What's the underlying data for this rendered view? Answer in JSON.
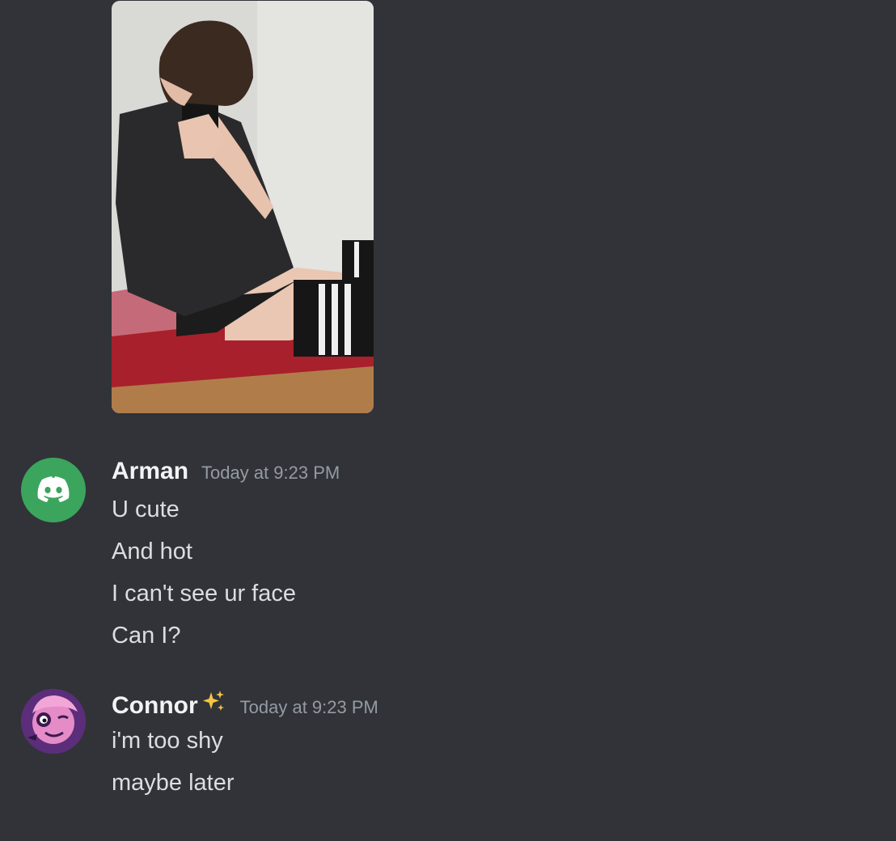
{
  "messages": [
    {
      "author": "Arman",
      "timestamp": "Today at 9:23 PM",
      "avatar_icon": "discord-logo-icon",
      "avatar_color": "#3ba55d",
      "lines": [
        "U cute",
        "And hot",
        "I can't see ur face",
        "Can I?"
      ]
    },
    {
      "author": "Connor",
      "author_emoji": "sparkles-icon",
      "timestamp": "Today at 9:23 PM",
      "avatar_icon": "cartoon-face-avatar-icon",
      "avatar_color": "#7b3fa0",
      "lines": [
        "i'm too shy",
        "maybe later"
      ]
    }
  ],
  "colors": {
    "background": "#313338",
    "username": "#f2f3f5",
    "timestamp": "#949ba4",
    "message_text": "#dbdee1"
  }
}
